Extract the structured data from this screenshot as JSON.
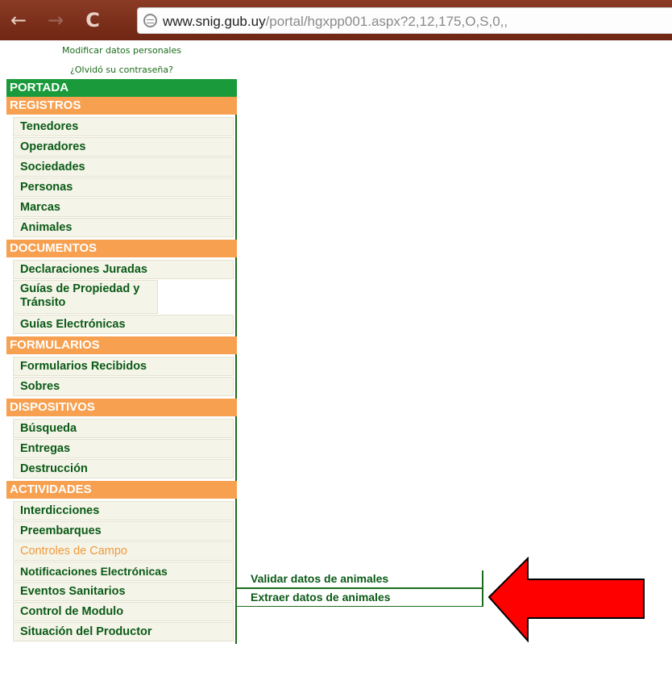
{
  "browser": {
    "url_host": "www.snig.gub.uy",
    "url_path": "/portal/hgxpp001.aspx?2,12,175,O,S,0,,",
    "back_icon": "arrow-left-icon",
    "forward_icon": "arrow-right-icon",
    "reload_icon": "reload-icon",
    "site_icon": "globe-icon"
  },
  "user_links": [
    "Modificar datos personales",
    "¿Olvidó su contraseña?"
  ],
  "portada": "PORTADA",
  "sections": {
    "registros": {
      "title": "REGISTROS",
      "items": [
        "Tenedores",
        "Operadores",
        "Sociedades",
        "Personas",
        "Marcas",
        "Animales"
      ]
    },
    "documentos": {
      "title": "DOCUMENTOS",
      "items": [
        "Declaraciones Juradas",
        "Guías de Propiedad y Tránsito",
        "Guías Electrónicas"
      ]
    },
    "formularios": {
      "title": "FORMULARIOS",
      "items": [
        "Formularios Recibidos",
        "Sobres"
      ]
    },
    "dispositivos": {
      "title": "DISPOSITIVOS",
      "items": [
        "Búsqueda",
        "Entregas",
        "Destrucción"
      ]
    },
    "actividades": {
      "title": "ACTIVIDADES",
      "items": [
        "Interdicciones",
        "Preembarques",
        "Controles de Campo",
        "Notificaciones Electrónicas",
        "Eventos Sanitarios",
        "Control de Modulo",
        "Situación del Productor"
      ]
    }
  },
  "submenu": [
    "Validar datos de animales",
    "Extraer datos de animales"
  ],
  "colors": {
    "green_dark": "#0a5a16",
    "green_header": "#1a9a3a",
    "orange_header": "#f7a04f",
    "active_orange": "#f09a3c",
    "arrow_red": "#ff0000"
  }
}
